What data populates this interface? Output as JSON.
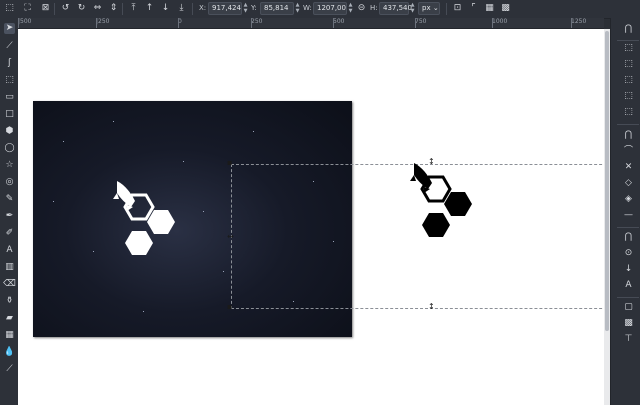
{
  "toolbar": {
    "x_label": "X:",
    "x_value": "917,424",
    "y_label": "Y:",
    "y_value": "85,814",
    "w_label": "W:",
    "w_value": "1207,00",
    "h_label": "H:",
    "h_value": "437,540",
    "unit": "px",
    "icons": [
      "select-all-icon",
      "select-all-layers-icon",
      "deselect-icon",
      "rotate-ccw-icon",
      "rotate-cw-icon",
      "flip-horizontal-icon",
      "flip-vertical-icon",
      "raise-to-top-icon",
      "raise-icon",
      "lower-icon",
      "lower-to-bottom-icon",
      "lock-ratio-icon",
      "scale-stroke-icon",
      "scale-corners-icon",
      "move-gradients-icon",
      "move-patterns-icon"
    ]
  },
  "ruler": {
    "labels": [
      "|500",
      "|250",
      "0",
      "250",
      "500",
      "750",
      "1000",
      "1250",
      "1500",
      "1750",
      "2000",
      "2250"
    ]
  },
  "tools": [
    "selector-tool",
    "node-tool",
    "tweak-tool",
    "zoom-tool",
    "measure-tool",
    "rectangle-tool",
    "3d-box-tool",
    "ellipse-tool",
    "star-tool",
    "spiral-tool",
    "pencil-tool",
    "pen-tool",
    "calligraphy-tool",
    "text-tool",
    "spray-tool",
    "eraser-tool",
    "paint-bucket-tool",
    "gradient-tool",
    "mesh-tool",
    "dropper-tool",
    "connector-tool"
  ],
  "snap": [
    "snap-toggle-icon",
    "snap-bbox-icon",
    "snap-bbox-edge-icon",
    "snap-bbox-corner-icon",
    "snap-bbox-midpoint-icon",
    "snap-bbox-center-icon",
    "snap-nodes-icon",
    "snap-path-icon",
    "snap-intersection-icon",
    "snap-cusp-icon",
    "snap-smooth-icon",
    "snap-line-midpoint-icon",
    "snap-object-center-icon",
    "snap-rotation-center-icon",
    "snap-text-baseline-icon",
    "snap-page-border-icon",
    "snap-grid-icon",
    "snap-guide-icon"
  ],
  "colors": {
    "chrome": "#2d3139",
    "canvas": "#ffffff",
    "photo_bg": "#12162a",
    "logo_white": "#ffffff",
    "logo_black": "#000000"
  }
}
